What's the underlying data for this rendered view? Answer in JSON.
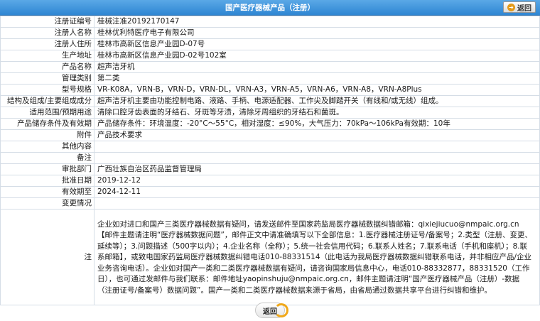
{
  "header": {
    "title": "国产医疗器械产品（注册）",
    "back_label": "返回"
  },
  "rows": [
    {
      "label": "注册证编号",
      "value": "桂械注准20192170147"
    },
    {
      "label": "注册人名称",
      "value": "桂林优利特医疗电子有限公司"
    },
    {
      "label": "注册人住所",
      "value": "桂林市高新区信息产业园D-07号"
    },
    {
      "label": "生产地址",
      "value": "桂林市高新区信息产业园D-02号102室"
    },
    {
      "label": "产品名称",
      "value": "超声洁牙机"
    },
    {
      "label": "管理类别",
      "value": "第二类"
    },
    {
      "label": "型号规格",
      "value": "VR-K08A，VRN-B，VRN-D，VRN-DL，VRN-A3，VRN-A5，VRN-A6，VRN-A8，VRN-A8Plus"
    },
    {
      "label": "结构及组成/主要组成成分",
      "value": "超声洁牙机主要由功能控制电路、液路、手柄、电源适配器、工作尖及脚踏开关（有线和/或无线）组成。"
    },
    {
      "label": "适用范围/预期用途",
      "value": "清除口腔牙齿表面的牙结石、牙斑等牙渍，清除牙周组织的牙结石和菌斑。"
    },
    {
      "label": "产品储存条件及有效期",
      "value": "产品储存条件：环境温度：-20°C～55°C，相对湿度：≤90%，大气压力：70kPa～106kPa有效期：10年"
    },
    {
      "label": "附件",
      "value": "产品技术要求"
    },
    {
      "label": "其他内容",
      "value": ""
    },
    {
      "label": "备注",
      "value": ""
    },
    {
      "label": "审批部门",
      "value": "广西壮族自治区药品监督管理局"
    },
    {
      "label": "批准日期",
      "value": "2019-12-12"
    },
    {
      "label": "有效期至",
      "value": "2024-12-11"
    },
    {
      "label": "变更情况",
      "value": ""
    }
  ],
  "note": {
    "label": "注",
    "text": "企业如对进口和国产三类医疗器械数据有疑问，请发送邮件至国家药监局医疗器械数据纠错邮箱：qixiejiucuo@nmpaic.org.cn【邮件主题请注明“医疗器械数据问题”，邮件正文中请准确填写以下全部信息：1.医疗器械注册证号/备案号；2.类型（注册、变更、延续等）；3.问题描述（500字以内）；4.企业名称（全称）；5.统一社会信用代码；6.联系人姓名；7.联系电话（手机和座机）；8.联系邮箱】，或致电国家药监局医疗器械数据纠错电话010-88331514（此电话为我局医疗器械数据纠错联系电话，并非相应产品/企业业务咨询电话）。企业如对国产一类和二类医疗器械数据有疑问，请咨询国家局信息中心，电话010-88332877，88331520（工作日），也可通过发邮件与我们联系：邮件地址yaopinshuju@nmpaic.org.cn，邮件主题请注明“国产医疗器械产品（注册）-数据（注册证号/备案号）数据问题”。国产一类和二类医疗器械数据来源于省局，由省局通过数据共享平台进行纠错和维护。"
  },
  "footer": {
    "back_label": "返回"
  },
  "colors": {
    "header_bg": "#2f86d3",
    "border": "#d5dde6",
    "back_accent": "#e39a1a"
  }
}
